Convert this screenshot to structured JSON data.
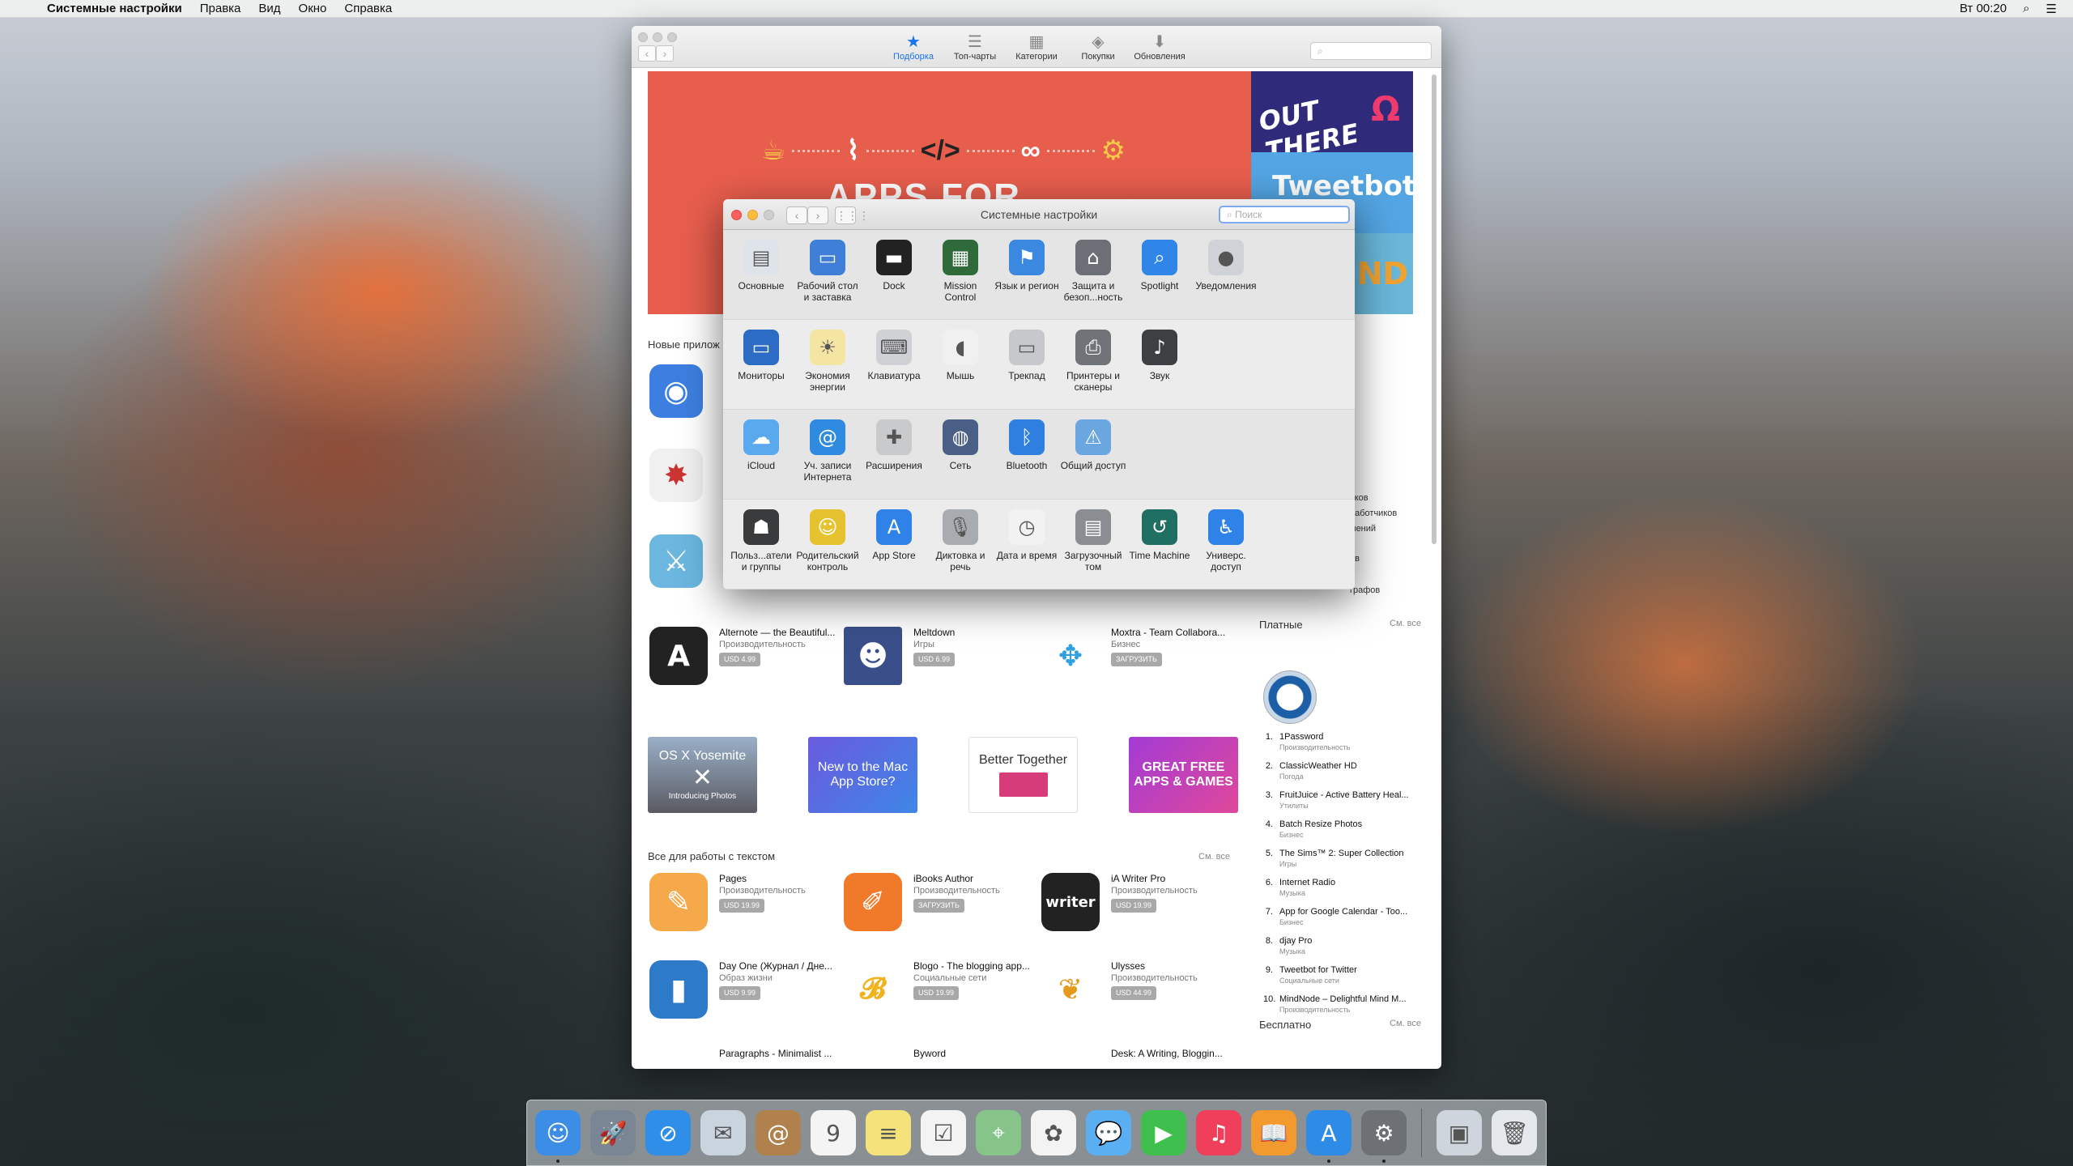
{
  "menubar": {
    "app": "Системные настройки",
    "items": [
      "Правка",
      "Вид",
      "Окно",
      "Справка"
    ],
    "clock": "Вт 00:20"
  },
  "appstore": {
    "tabs": [
      {
        "label": "Подборка",
        "icon": "star-icon",
        "active": true
      },
      {
        "label": "Топ-чарты",
        "icon": "list-icon"
      },
      {
        "label": "Категории",
        "icon": "box-icon"
      },
      {
        "label": "Покупки",
        "icon": "tag-icon"
      },
      {
        "label": "Обновления",
        "icon": "download-icon"
      }
    ],
    "banner_text": "APPS FOR",
    "side_banners": [
      "OUT THERE",
      "Ω",
      "Tweetbot",
      "ND"
    ],
    "new_apps_title": "Новые прилож",
    "apps": [
      {
        "name": "Alternote — the Beautiful...",
        "cat": "Производительность",
        "price": "USD 4.99"
      },
      {
        "name": "Meltdown",
        "cat": "Игры",
        "price": "USD 6.99"
      },
      {
        "name": "Moxtra - Team Collabora...",
        "cat": "Бизнес",
        "price": "ЗАГРУЗИТЬ"
      }
    ],
    "promos": [
      "OS X Yosemite",
      "Introducing Photos",
      "New to the Mac App Store?",
      "Better Together",
      "GREAT FREE APPS & GAMES"
    ],
    "text_section": {
      "title": "Все для работы с текстом",
      "see_all": "См. все"
    },
    "text_apps": [
      {
        "name": "Pages",
        "cat": "Производительность",
        "price": "USD 19.99"
      },
      {
        "name": "iBooks Author",
        "cat": "Производительность",
        "price": "ЗАГРУЗИТЬ"
      },
      {
        "name": "iA Writer Pro",
        "cat": "Производительность",
        "price": "USD 19.99"
      },
      {
        "name": "Day One (Журнал / Дне...",
        "cat": "Образ жизни",
        "price": "USD 9.99"
      },
      {
        "name": "Blogo - The blogging app...",
        "cat": "Социальные сети",
        "price": "USD 19.99"
      },
      {
        "name": "Ulysses",
        "cat": "Производительность",
        "price": "USD 44.99"
      },
      {
        "name": "Paragraphs - Minimalist ...",
        "cat": "",
        "price": ""
      },
      {
        "name": "Byword",
        "cat": "",
        "price": ""
      },
      {
        "name": "Desk: A Writing, Bloggin...",
        "cat": "",
        "price": ""
      }
    ],
    "paid": {
      "title": "Платные",
      "see_all": "См. все"
    },
    "free": {
      "title": "Бесплатно",
      "see_all": "См. все"
    },
    "side_fragments": [
      "чков",
      "работчиков",
      "мений",
      "ов",
      "графов"
    ],
    "chart": [
      {
        "n": "1.",
        "name": "1Password",
        "cat": "Производительность"
      },
      {
        "n": "2.",
        "name": "ClassicWeather HD",
        "cat": "Погода"
      },
      {
        "n": "3.",
        "name": "FruitJuice - Active Battery Heal...",
        "cat": "Утилиты"
      },
      {
        "n": "4.",
        "name": "Batch Resize Photos",
        "cat": "Бизнес"
      },
      {
        "n": "5.",
        "name": "The Sims™ 2: Super Collection",
        "cat": "Игры"
      },
      {
        "n": "6.",
        "name": "Internet Radio",
        "cat": "Музыка"
      },
      {
        "n": "7.",
        "name": "App for Google Calendar - Too...",
        "cat": "Бизнес"
      },
      {
        "n": "8.",
        "name": "djay Pro",
        "cat": "Музыка"
      },
      {
        "n": "9.",
        "name": "Tweetbot for Twitter",
        "cat": "Социальные сети"
      },
      {
        "n": "10.",
        "name": "MindNode – Delightful Mind M...",
        "cat": "Производительность"
      }
    ]
  },
  "prefs": {
    "title": "Системные настройки",
    "search_placeholder": "Поиск",
    "rows": [
      [
        {
          "l": "Основные",
          "i": "general-icon",
          "c": "#dfe3ea",
          "g": "▤"
        },
        {
          "l": "Рабочий стол и заставка",
          "i": "desktop-icon",
          "c": "#3f7fd8",
          "g": "▭"
        },
        {
          "l": "Dock",
          "i": "dock-icon",
          "c": "#222",
          "g": "▬"
        },
        {
          "l": "Mission Control",
          "i": "mission-control-icon",
          "c": "#2f6b3a",
          "g": "▦"
        },
        {
          "l": "Язык и регион",
          "i": "flag-icon",
          "c": "#3a88e0",
          "g": "⚑"
        },
        {
          "l": "Защита и безоп...ность",
          "i": "house-lock-icon",
          "c": "#6c7076",
          "g": "⌂"
        },
        {
          "l": "Spotlight",
          "i": "spotlight-icon",
          "c": "#2f86e8",
          "g": "⌕"
        },
        {
          "l": "Уведомления",
          "i": "notifications-icon",
          "c": "#cfd3d8",
          "g": "●"
        }
      ],
      [
        {
          "l": "Мониторы",
          "i": "monitor-icon",
          "c": "#2c6cc4",
          "g": "▭"
        },
        {
          "l": "Экономия энергии",
          "i": "bulb-icon",
          "c": "#f4e6a2",
          "g": "☀"
        },
        {
          "l": "Клавиатура",
          "i": "keyboard-icon",
          "c": "#cfd1d4",
          "g": "⌨"
        },
        {
          "l": "Мышь",
          "i": "mouse-icon",
          "c": "#f0f0f0",
          "g": "◖"
        },
        {
          "l": "Трекпад",
          "i": "trackpad-icon",
          "c": "#c6c8cb",
          "g": "▭"
        },
        {
          "l": "Принтеры и сканеры",
          "i": "printer-icon",
          "c": "#707478",
          "g": "⎙"
        },
        {
          "l": "Звук",
          "i": "speaker-icon",
          "c": "#3d3f42",
          "g": "♪"
        }
      ],
      [
        {
          "l": "iCloud",
          "i": "icloud-icon",
          "c": "#5aa9ee",
          "g": "☁"
        },
        {
          "l": "Уч. записи Интернета",
          "i": "at-icon",
          "c": "#2e8be0",
          "g": "@"
        },
        {
          "l": "Расширения",
          "i": "puzzle-icon",
          "c": "#c8cacc",
          "g": "✚"
        },
        {
          "l": "Сеть",
          "i": "globe-icon",
          "c": "#4a5f86",
          "g": "◍"
        },
        {
          "l": "Bluetooth",
          "i": "bluetooth-icon",
          "c": "#2e7fe0",
          "g": "ᛒ"
        },
        {
          "l": "Общий доступ",
          "i": "sharing-icon",
          "c": "#6aa6e0",
          "g": "⚠"
        }
      ],
      [
        {
          "l": "Польз...атели и группы",
          "i": "users-icon",
          "c": "#3a3b3d",
          "g": "☗"
        },
        {
          "l": "Родительский контроль",
          "i": "parental-icon",
          "c": "#e6c22f",
          "g": "☺"
        },
        {
          "l": "App Store",
          "i": "appstore-icon",
          "c": "#2e82e8",
          "g": "A"
        },
        {
          "l": "Диктовка и речь",
          "i": "microphone-icon",
          "c": "#a8abb0",
          "g": "🎙"
        },
        {
          "l": "Дата и время",
          "i": "clock-icon",
          "c": "#f2f2f2",
          "g": "◷"
        },
        {
          "l": "Загрузочный том",
          "i": "disk-icon",
          "c": "#8a8d91",
          "g": "▤"
        },
        {
          "l": "Time Machine",
          "i": "time-machine-icon",
          "c": "#1f6f63",
          "g": "↺"
        },
        {
          "l": "Универс. доступ",
          "i": "accessibility-icon",
          "c": "#2e82e8",
          "g": "♿"
        }
      ]
    ]
  },
  "dock": [
    {
      "n": "finder-icon",
      "c": "#3c8de6",
      "g": "☺",
      "dot": true
    },
    {
      "n": "launchpad-icon",
      "c": "#7a8694",
      "g": "🚀"
    },
    {
      "n": "safari-icon",
      "c": "#2f8fe8",
      "g": "⊘"
    },
    {
      "n": "mail-icon",
      "c": "#c9d4de",
      "g": "✉"
    },
    {
      "n": "contacts-icon",
      "c": "#b0804d",
      "g": "@"
    },
    {
      "n": "calendar-icon",
      "c": "#f4f4f4",
      "g": "9"
    },
    {
      "n": "notes-icon",
      "c": "#f5e27a",
      "g": "≡"
    },
    {
      "n": "reminders-icon",
      "c": "#f3f3f3",
      "g": "☑"
    },
    {
      "n": "maps-icon",
      "c": "#86c48a",
      "g": "⌖"
    },
    {
      "n": "photos-icon",
      "c": "#f3f3f3",
      "g": "✿"
    },
    {
      "n": "messages-icon",
      "c": "#5aaef2",
      "g": "💬"
    },
    {
      "n": "facetime-icon",
      "c": "#3fbf4d",
      "g": "▶"
    },
    {
      "n": "itunes-icon",
      "c": "#ef3f5a",
      "g": "♫"
    },
    {
      "n": "ibooks-icon",
      "c": "#f29a2e",
      "g": "📖"
    },
    {
      "n": "appstore-icon",
      "c": "#2e8be6",
      "g": "A",
      "dot": true
    },
    {
      "n": "system-preferences-icon",
      "c": "#6d7176",
      "g": "⚙",
      "dot": true
    },
    {
      "n": "photo-folder-icon",
      "c": "#cfd5dc",
      "g": "▣"
    },
    {
      "n": "trash-icon",
      "c": "#e5e8ec",
      "g": "🗑"
    }
  ]
}
